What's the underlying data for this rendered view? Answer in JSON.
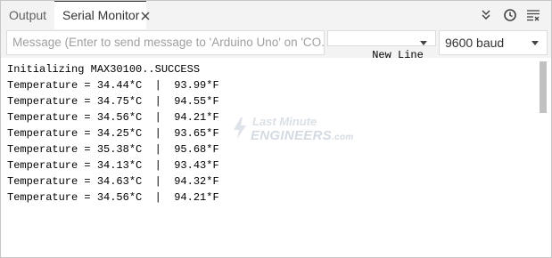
{
  "tabs": {
    "output": "Output",
    "serial": "Serial Monitor"
  },
  "icons": {
    "close": "close-icon",
    "collapse": "double-chevron-down-icon",
    "timestamp": "clock-icon",
    "clear": "clear-output-icon"
  },
  "input": {
    "placeholder": "Message (Enter to send message to 'Arduino Uno' on 'CO...",
    "line_ending": "New Line",
    "baud": "9600 baud"
  },
  "serial_lines": [
    "Initializing MAX30100..SUCCESS",
    "Temperature = 34.44*C  |  93.99*F",
    "Temperature = 34.75*C  |  94.55*F",
    "Temperature = 34.56*C  |  94.21*F",
    "Temperature = 34.25*C  |  93.65*F",
    "Temperature = 35.38*C  |  95.68*F",
    "Temperature = 34.13*C  |  93.43*F",
    "Temperature = 34.63*C  |  94.32*F",
    "Temperature = 34.56*C  |  94.21*F"
  ],
  "watermark": {
    "top": "Last Minute",
    "bottom": "ENGINEERS",
    "suffix": ".com"
  }
}
